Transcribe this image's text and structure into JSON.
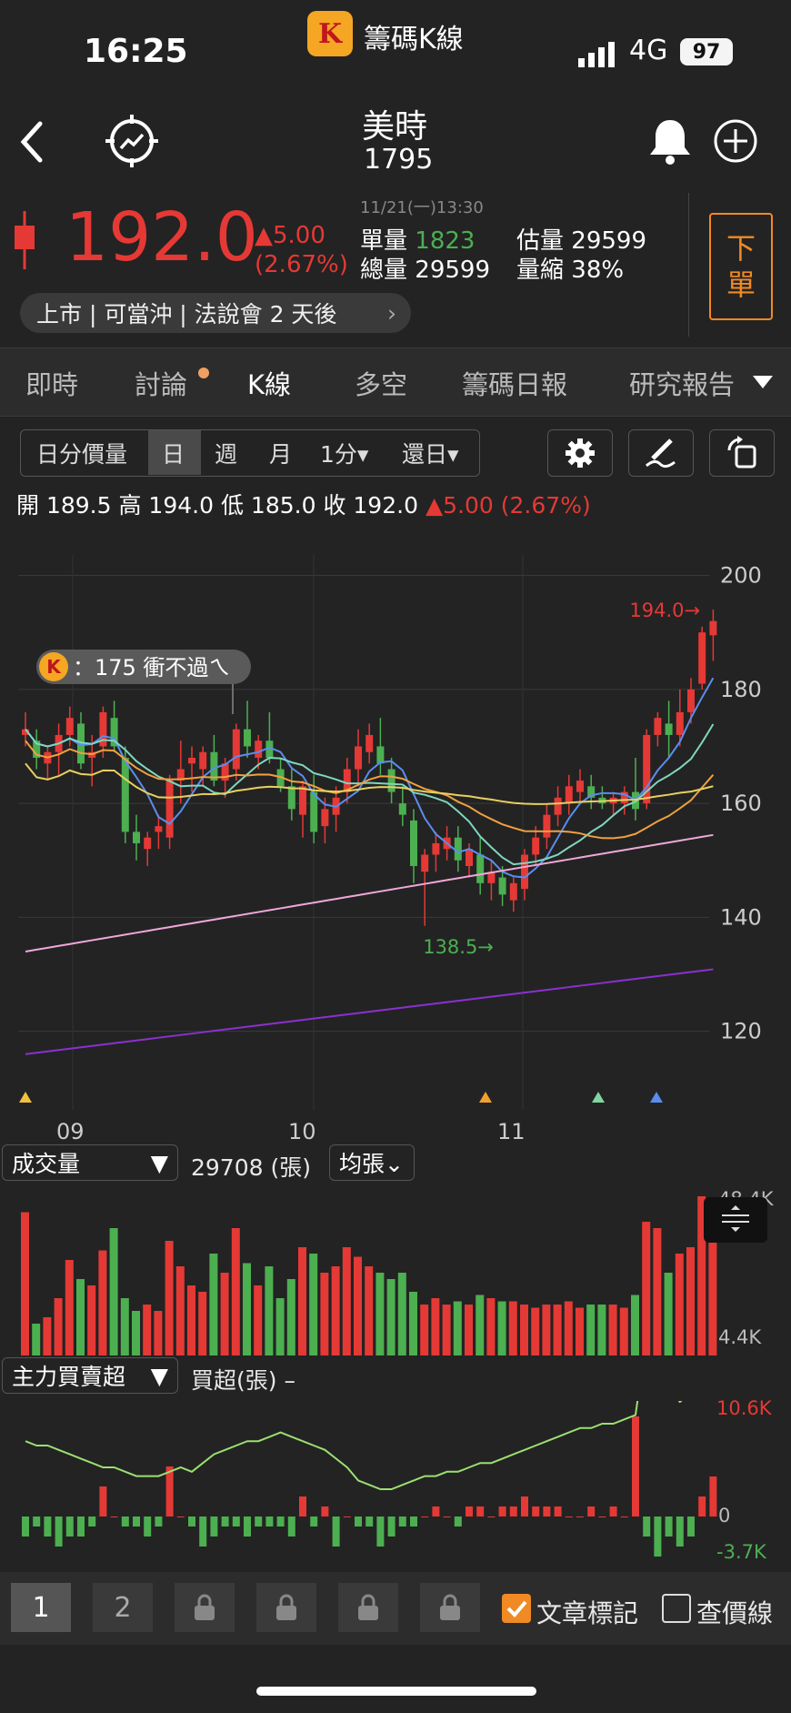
{
  "status_bar": {
    "time": "16:25",
    "app_name": "籌碼K線",
    "network": "4G",
    "battery": "97"
  },
  "header": {
    "stock_name": "美時",
    "stock_code": "1795"
  },
  "quote": {
    "price": "192.0",
    "change": "▲5.00",
    "change_pct": "(2.67%)",
    "datetime": "11/21(一)13:30",
    "single_vol_label": "單量",
    "single_vol": "1823",
    "est_vol_label": "估量",
    "est_vol": "29599",
    "total_vol_label": "總量",
    "total_vol": "29599",
    "shrink_label": "量縮",
    "shrink": "38%",
    "order_button": [
      "下",
      "單"
    ],
    "tags": "上市 | 可當沖 | 法說會 2 天後"
  },
  "tabs": [
    "即時",
    "討論",
    "K線",
    "多空",
    "籌碼日報",
    "研究報告"
  ],
  "toolbar": {
    "segments": [
      "日分價量",
      "日",
      "週",
      "月",
      "1分▾",
      "還日▾"
    ]
  },
  "ohlc": {
    "open": "開 189.5",
    "high": "高 194.0",
    "low": "低 185.0",
    "close": "收 192.0",
    "change": "▲5.00 (2.67%)"
  },
  "chart_labels": {
    "y_ticks": [
      "200",
      "180",
      "160",
      "140",
      "120"
    ],
    "x_ticks": [
      "09",
      "10",
      "11"
    ],
    "high_marker": "194.0→",
    "low_marker": "138.5→",
    "note": "：175 衝不過ㄟ"
  },
  "volume": {
    "selector": "成交量",
    "value": "29708 (張)",
    "avg_selector": "均張⌄",
    "top": "48.4K",
    "bottom": "4.4K"
  },
  "mainforce": {
    "selector": "主力買賣超",
    "label": "買超(張) –",
    "top": "10.6K",
    "zero": "0",
    "bottom": "-3.7K"
  },
  "bottom_bar": {
    "pages": [
      "1",
      "2"
    ],
    "article_mark": "文章標記",
    "price_line": "查價線"
  },
  "colors": {
    "up": "#e53935",
    "down": "#4caf50",
    "accent": "#f08a24"
  },
  "chart_data": {
    "type": "candlestick",
    "ylim": [
      115,
      202
    ],
    "candles": [
      [
        172,
        176,
        170,
        173
      ],
      [
        171,
        173,
        166,
        168
      ],
      [
        167,
        170,
        164,
        169
      ],
      [
        169,
        174,
        165,
        172
      ],
      [
        172,
        177,
        170,
        175
      ],
      [
        174,
        176,
        166,
        167
      ],
      [
        168,
        172,
        163,
        169
      ],
      [
        170,
        177,
        168,
        176
      ],
      [
        175,
        178,
        169,
        170
      ],
      [
        168,
        170,
        153,
        155
      ],
      [
        155,
        158,
        150,
        153
      ],
      [
        152,
        155,
        149,
        154
      ],
      [
        155,
        158,
        152,
        156
      ],
      [
        154,
        165,
        152,
        164
      ],
      [
        164,
        171,
        160,
        166
      ],
      [
        167,
        170,
        162,
        168
      ],
      [
        166,
        170,
        163,
        169
      ],
      [
        169,
        172,
        163,
        164
      ],
      [
        164,
        168,
        161,
        167
      ],
      [
        166,
        174,
        164,
        173
      ],
      [
        173,
        178,
        168,
        170
      ],
      [
        168,
        172,
        166,
        171
      ],
      [
        171,
        176,
        167,
        168
      ],
      [
        166,
        168,
        162,
        163
      ],
      [
        163,
        166,
        157,
        159
      ],
      [
        158,
        164,
        154,
        163
      ],
      [
        162,
        165,
        153,
        155
      ],
      [
        156,
        161,
        153,
        159
      ],
      [
        158,
        163,
        155,
        161
      ],
      [
        162,
        168,
        160,
        166
      ],
      [
        166,
        173,
        163,
        170
      ],
      [
        169,
        174,
        167,
        172
      ],
      [
        170,
        175,
        165,
        167
      ],
      [
        166,
        168,
        160,
        162
      ],
      [
        160,
        163,
        156,
        158
      ],
      [
        157,
        159,
        146,
        149
      ],
      [
        148,
        152,
        138.5,
        151
      ],
      [
        151,
        155,
        148,
        153
      ],
      [
        152,
        156,
        150,
        154
      ],
      [
        154,
        156,
        148,
        150
      ],
      [
        149,
        153,
        147,
        152
      ],
      [
        151,
        154,
        144,
        146
      ],
      [
        146,
        150,
        143,
        148
      ],
      [
        147,
        149,
        142,
        144
      ],
      [
        143,
        147,
        141,
        146
      ],
      [
        145,
        152,
        143,
        151
      ],
      [
        151,
        156,
        149,
        154
      ],
      [
        154,
        160,
        152,
        158
      ],
      [
        158,
        163,
        156,
        161
      ],
      [
        160,
        165,
        158,
        163
      ],
      [
        162,
        166,
        160,
        164
      ],
      [
        163,
        165,
        159,
        161
      ],
      [
        161,
        163,
        159,
        160
      ],
      [
        160,
        162,
        158,
        161
      ],
      [
        160,
        163,
        158,
        162
      ],
      [
        162,
        168,
        157,
        159
      ],
      [
        160,
        173,
        159,
        172
      ],
      [
        172,
        176,
        170,
        175
      ],
      [
        174,
        178,
        168,
        172
      ],
      [
        172,
        180,
        170,
        176
      ],
      [
        176,
        182,
        174,
        180
      ],
      [
        181,
        191,
        180,
        190
      ],
      [
        189.5,
        194,
        185,
        192
      ]
    ],
    "volume_heights": [
      45,
      10,
      12,
      18,
      30,
      24,
      22,
      33,
      40,
      18,
      14,
      16,
      14,
      36,
      28,
      22,
      20,
      32,
      26,
      40,
      29,
      22,
      28,
      18,
      24,
      34,
      32,
      26,
      28,
      34,
      31,
      28,
      26,
      24,
      26,
      20,
      16,
      18,
      16,
      17,
      16,
      19,
      18,
      17,
      17,
      16,
      15,
      16,
      16,
      17,
      15,
      16,
      16,
      16,
      15,
      19,
      42,
      40,
      26,
      32,
      34,
      50,
      40
    ],
    "mainforce": [
      -2,
      -1,
      -2,
      -3,
      -2,
      -2,
      -1,
      3,
      0,
      -1,
      -1,
      -2,
      -1,
      5,
      0,
      -1,
      -3,
      -2,
      -1,
      -1,
      -2,
      -1,
      -1,
      -1,
      -2,
      2,
      -1,
      1,
      -3,
      0,
      -1,
      -1,
      -3,
      -2,
      -1,
      -1,
      0,
      1,
      0,
      -1,
      1,
      1,
      0,
      1,
      1,
      2,
      1,
      1,
      1,
      0,
      0,
      1,
      0,
      1,
      0,
      10,
      -2,
      -4,
      -2,
      -3,
      -2,
      2,
      4
    ]
  }
}
